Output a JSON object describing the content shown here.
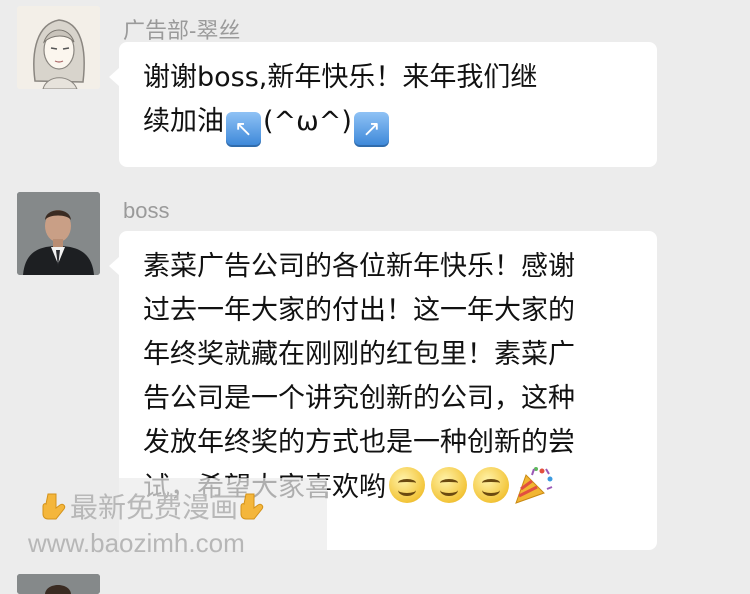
{
  "messages": [
    {
      "sender": "广告部-翠丝",
      "lines": [
        "谢谢boss,新年快乐！来年我们继",
        "续加油"
      ],
      "emoji_arrow_left": "↖",
      "emoji_face": "(^ω^)",
      "emoji_arrow_right": "↗"
    },
    {
      "sender": "boss",
      "lines": [
        "素菜广告公司的各位新年快乐！感谢",
        "过去一年大家的付出！这一年大家的",
        "年终奖就藏在刚刚的红包里！素菜广",
        "告公司是一个讲究创新的公司，这种",
        "发放年终奖的方式也是一种创新的尝",
        "试，希望大家喜欢哟"
      ],
      "emoji_icons": [
        "smile-icon",
        "smile-icon",
        "smile-icon",
        "party-popper-icon"
      ]
    }
  ],
  "watermark": {
    "line1": "最新免费漫画",
    "line2": "www.baozimh.com"
  }
}
